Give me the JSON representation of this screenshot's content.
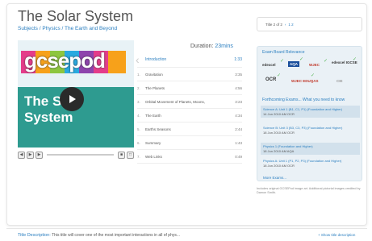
{
  "header": {
    "title": "The Solar System",
    "breadcrumb": "Subjects / Physics / The Earth and Beyond"
  },
  "duration": {
    "label": "Duration:",
    "value": "23mins"
  },
  "video": {
    "logo_text": "gcsepod",
    "overlay_line1": "The S",
    "overlay_line2": "System"
  },
  "chapters": [
    {
      "num": "",
      "name": "Introduction",
      "time": "1:33"
    },
    {
      "num": "1.",
      "name": "Gravitation",
      "time": "3:35"
    },
    {
      "num": "2.",
      "name": "The Planets",
      "time": "4:56"
    },
    {
      "num": "3.",
      "name": "Orbital Movement of Planets, Moons,",
      "time": "3:23"
    },
    {
      "num": "4.",
      "name": "The Earth",
      "time": "4:34"
    },
    {
      "num": "5.",
      "name": "Earths Seasons",
      "time": "2:44"
    },
    {
      "num": "6.",
      "name": "Summary",
      "time": "1:43"
    },
    {
      "num": "7.",
      "name": "Web Links",
      "time": "0:49"
    }
  ],
  "pager": {
    "text": "Title 2 of 2",
    "prev": "‹",
    "pages": "1  2"
  },
  "exam_board": {
    "title": "Exam Board Relevance",
    "boards": [
      "edexcel",
      "AQA",
      "WJEC",
      "edexcel IGCSE",
      "OCR",
      "WJEC EDUQAS",
      "CIE"
    ],
    "forthcoming_title": "Forthcoming Exams... What you need to know",
    "exams": [
      {
        "name": "Science A: Unit 1 (B1, C1, P1) (Foundation and Higher)",
        "meta": "14 Jun 2010 AM  OCR"
      },
      {
        "name": "Science B: Unit 3 (B3, C3, P3) (Foundation and Higher)",
        "meta": "18 Jun 2010 AM  OCR"
      },
      {
        "name": "Physics 1 (Foundation and Higher)",
        "meta": "18 Jun 2010 AM  AQA"
      },
      {
        "name": "Physics A: Unit 1 (P1, P2, P3) (Foundation and Higher)",
        "meta": "18 Jun 2010 AM  OCR"
      }
    ],
    "more": "More Exams..."
  },
  "credits": "Includes original GCSEPod image art. Additional pictorial images credited by Damon Smith.",
  "description": {
    "label": "Title Description:",
    "text": "This title will cover one of the most important interactions in all of phys...",
    "toggle": "+ Show title description"
  },
  "colors": {
    "accent": "#2b7fc0",
    "video_bg": "#2e9b90",
    "panel_bg": "#eaf1f6"
  },
  "controls": {
    "rewind_icon": "rewind-icon",
    "play_icon": "play-icon",
    "forward_icon": "forward-icon",
    "fullscreen_icon": "fullscreen-icon",
    "volume_icon": "volume-icon"
  }
}
